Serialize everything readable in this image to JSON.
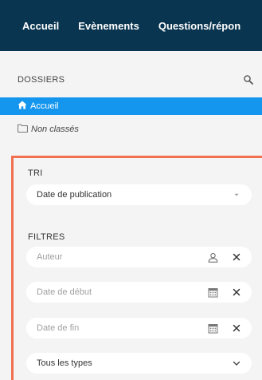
{
  "nav": {
    "items": [
      "Accueil",
      "Evènements",
      "Questions/répon"
    ]
  },
  "dossiers": {
    "title": "DOSSIERS",
    "items": [
      {
        "label": "Accueil",
        "icon": "home-icon"
      },
      {
        "label": "Non classés",
        "icon": "folder-icon"
      }
    ]
  },
  "tri": {
    "label": "TRI",
    "selected": "Date de publication"
  },
  "filtres": {
    "label": "FILTRES",
    "auteur_placeholder": "Auteur",
    "date_debut_placeholder": "Date de début",
    "date_fin_placeholder": "Date de fin",
    "types_selected": "Tous les types"
  },
  "colors": {
    "nav_bg": "#0a3550",
    "active_bg": "#1596ee",
    "highlight_border": "#f07050",
    "panel_bg": "#f4f4f4"
  }
}
